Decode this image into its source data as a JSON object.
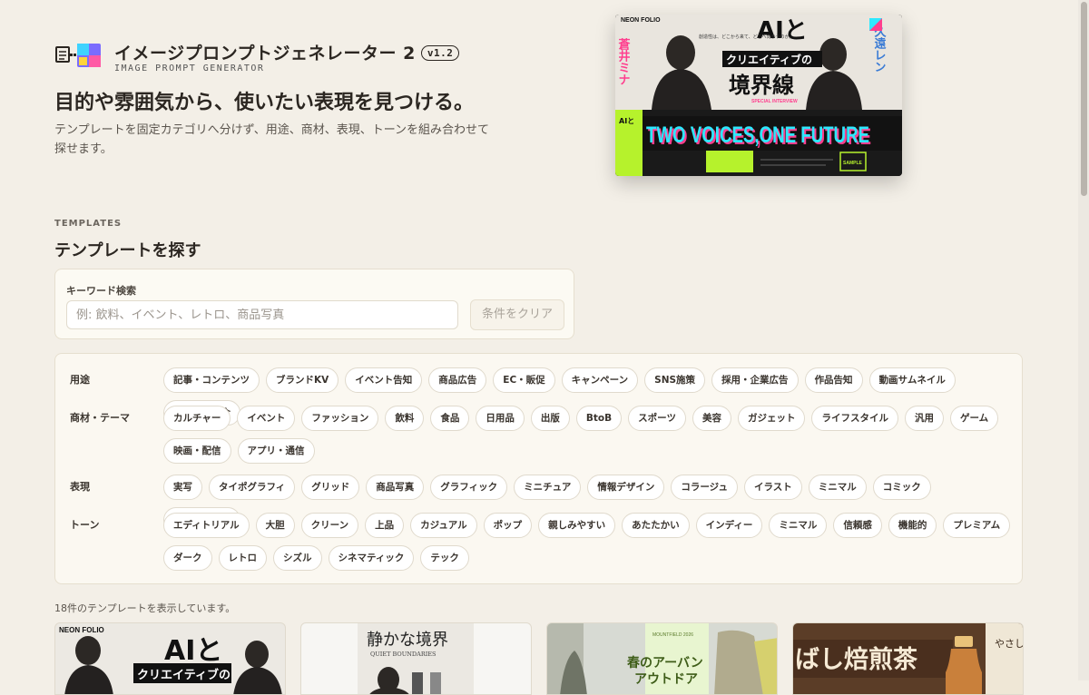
{
  "app": {
    "title": "イメージプロンプトジェネレーター 2",
    "version": "v1.2",
    "subtitle": "IMAGE PROMPT GENERATOR"
  },
  "hero": {
    "title": "目的や雰囲気から、使いたい表現を見つける。",
    "description": "テンプレートを固定カテゴリへ分けず、用途、商材、表現、トーンを組み合わせて探せます。",
    "image": {
      "brand": "NEON FOLIO",
      "headline_top": "AIと",
      "headline_mid": "クリエイティブの",
      "headline_main": "境界線",
      "name_left": "蒼井ミナ",
      "name_right": "久遠レン",
      "special": "SPECIAL INTERVIEW",
      "banner": "TWO VOICES,ONE FUTURE",
      "caption": "創造性は、どこから来て、どこへ向かうのか。",
      "sample": "SAMPLE"
    }
  },
  "templates": {
    "eyebrow": "TEMPLATES",
    "title": "テンプレートを探す",
    "search": {
      "label": "キーワード検索",
      "placeholder": "例: 飲料、イベント、レトロ、商品写真",
      "value": ""
    },
    "clear_label": "条件をクリア",
    "filters": [
      {
        "label": "用途",
        "chips": [
          "記事・コンテンツ",
          "ブランドKV",
          "イベント告知",
          "商品広告",
          "EC・販促",
          "キャンペーン",
          "SNS施策",
          "採用・企業広告",
          "作品告知",
          "動画サムネイル",
          "サービス紹介"
        ]
      },
      {
        "label": "商材・テーマ",
        "chips": [
          "カルチャー",
          "イベント",
          "ファッション",
          "飲料",
          "食品",
          "日用品",
          "出版",
          "BtoB",
          "スポーツ",
          "美容",
          "ガジェット",
          "ライフスタイル",
          "汎用",
          "ゲーム",
          "映画・配信",
          "アプリ・通信"
        ]
      },
      {
        "label": "表現",
        "chips": [
          "実写",
          "タイポグラフィ",
          "グリッド",
          "商品写真",
          "グラフィック",
          "ミニチュア",
          "情報デザイン",
          "コラージュ",
          "イラスト",
          "ミニマル",
          "コミック",
          "キャラクター"
        ]
      },
      {
        "label": "トーン",
        "chips": [
          "エディトリアル",
          "大胆",
          "クリーン",
          "上品",
          "カジュアル",
          "ポップ",
          "親しみやすい",
          "あたたかい",
          "インディー",
          "ミニマル",
          "信頼感",
          "機能的",
          "プレミアム",
          "ダーク",
          "レトロ",
          "シズル",
          "シネマティック",
          "テック"
        ]
      }
    ],
    "result_count": "18件のテンプレートを表示しています。",
    "cards": [
      {
        "brand": "NEON FOLIO",
        "heading": "AIと",
        "sub": "クリエイティブの"
      },
      {
        "heading": "静かな境界",
        "sub": "QUIET BOUNDARIES"
      },
      {
        "label": "MOUNTFIELD 2026",
        "heading": "春のアーバン",
        "sub": "アウトドア"
      },
      {
        "heading": "ばし焙煎茶",
        "side": "やさし"
      }
    ]
  },
  "colors": {
    "background": "#f3efe7",
    "panel": "#fbf8f1",
    "accent_green": "#b6f22c",
    "accent_pink": "#ff3e8e",
    "accent_cyan": "#2ee8ff"
  }
}
